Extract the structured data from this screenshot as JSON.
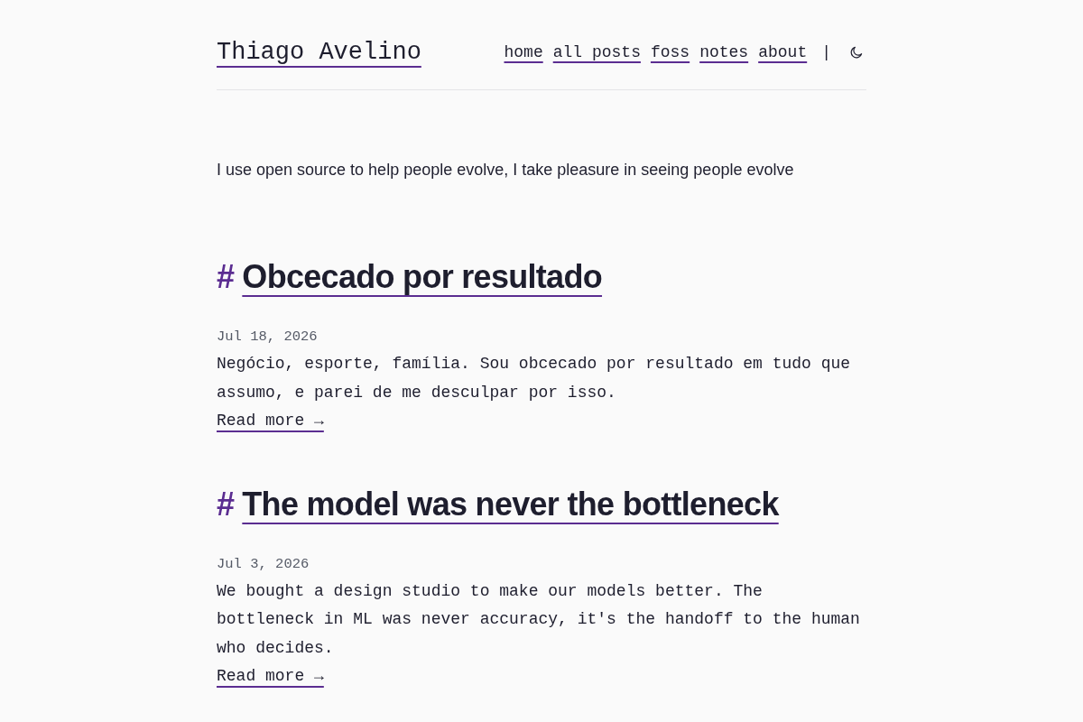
{
  "site": {
    "title": "Thiago Avelino",
    "description": "I use open source to help people evolve, I take pleasure in seeing people evolve"
  },
  "nav": {
    "links": [
      {
        "label": "home"
      },
      {
        "label": "all posts"
      },
      {
        "label": "foss"
      },
      {
        "label": "notes"
      },
      {
        "label": "about"
      }
    ],
    "separator": "|"
  },
  "posts": [
    {
      "marker": "#",
      "title": "Obcecado por resultado",
      "date": "Jul 18, 2026",
      "excerpt": "Negócio, esporte, família. Sou obcecado por resultado em tudo que assumo, e parei de me desculpar por isso.",
      "link": "Read more →"
    },
    {
      "marker": "#",
      "title": "The model was never the bottleneck",
      "date": "Jul 3, 2026",
      "excerpt": "We bought a design studio to make our models better. The bottleneck in ML was never accuracy, it's the handoff to the human who decides.",
      "link": "Read more →"
    }
  ]
}
